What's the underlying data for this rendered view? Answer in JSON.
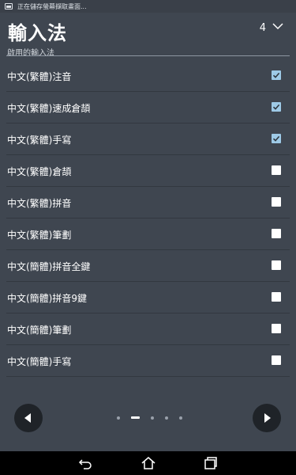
{
  "status_bar": {
    "notification_text": "正在儲存螢幕擷取畫面..."
  },
  "header": {
    "title": "輸入法",
    "page_count": "4"
  },
  "section": {
    "label": "啟用的輸入法"
  },
  "input_methods": [
    {
      "label": "中文(繁體)注音",
      "checked": true
    },
    {
      "label": "中文(繁體)速成倉頡",
      "checked": true
    },
    {
      "label": "中文(繁體)手寫",
      "checked": true
    },
    {
      "label": "中文(繁體)倉頡",
      "checked": false
    },
    {
      "label": "中文(繁體)拼音",
      "checked": false
    },
    {
      "label": "中文(繁體)筆劃",
      "checked": false
    },
    {
      "label": "中文(簡體)拼音全鍵",
      "checked": false
    },
    {
      "label": "中文(簡體)拼音9鍵",
      "checked": false
    },
    {
      "label": "中文(簡體)筆劃",
      "checked": false
    },
    {
      "label": "中文(簡體)手寫",
      "checked": false
    }
  ],
  "pager": {
    "total_pages": 5,
    "current_page": 2
  },
  "colors": {
    "background": "#3f4650",
    "checkbox_checked": "#9ecae7",
    "checkbox_unchecked": "#ffffff"
  },
  "icons": {
    "status": "screenshot-notification-icon",
    "dropdown": "chevron-down-icon",
    "prev": "arrow-left-icon",
    "next": "arrow-right-icon",
    "back": "back-icon",
    "home": "home-icon",
    "recents": "recents-icon"
  }
}
